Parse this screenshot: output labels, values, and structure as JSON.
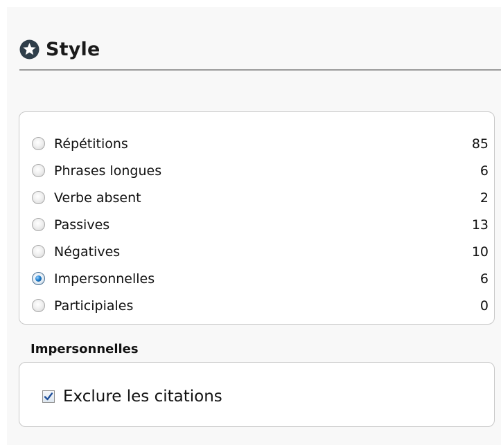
{
  "panel": {
    "title": "Style",
    "title_icon": "star-circle-icon"
  },
  "style_list": {
    "items": [
      {
        "label": "Répétitions",
        "count": "85",
        "selected": false
      },
      {
        "label": "Phrases longues",
        "count": "6",
        "selected": false
      },
      {
        "label": "Verbe absent",
        "count": "2",
        "selected": false
      },
      {
        "label": "Passives",
        "count": "13",
        "selected": false
      },
      {
        "label": "Négatives",
        "count": "10",
        "selected": false
      },
      {
        "label": "Impersonnelles",
        "count": "6",
        "selected": true
      },
      {
        "label": "Participiales",
        "count": "0",
        "selected": false
      }
    ]
  },
  "options": {
    "section_title": "Impersonnelles",
    "exclude_quotes_label": "Exclure les citations",
    "exclude_quotes_checked": true
  },
  "colors": {
    "panel_background": "#f8f8f8",
    "rule": "#9a9a9a",
    "icon": "#2f3e4a",
    "radio_selected": "#1d7fd0",
    "checkmark": "#1f4f9a"
  }
}
